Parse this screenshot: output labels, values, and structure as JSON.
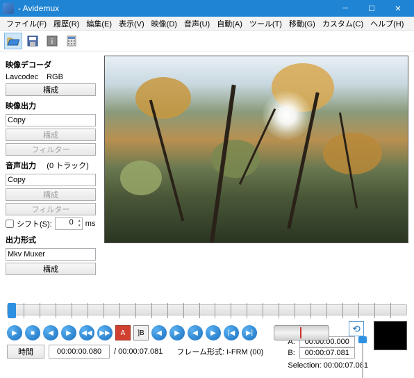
{
  "title": "- Avidemux",
  "menu": [
    "ファイル(F)",
    "履歴(R)",
    "編集(E)",
    "表示(V)",
    "映像(D)",
    "音声(U)",
    "自動(A)",
    "ツール(T)",
    "移動(G)",
    "カスタム(C)",
    "ヘルプ(H)"
  ],
  "sidebar": {
    "decoder_hdr": "映像デコーダ",
    "decoder_codec": "Lavcodec",
    "decoder_fmt": "RGB",
    "configure": "構成",
    "video_out_hdr": "映像出力",
    "video_out_value": "Copy",
    "filter": "フィルター",
    "audio_out_hdr": "音声出力",
    "audio_tracks": "(0 トラック)",
    "audio_out_value": "Copy",
    "shift_label": "シフト(S):",
    "shift_value": "0",
    "shift_unit": "ms",
    "format_hdr": "出力形式",
    "format_value": "Mkv Muxer"
  },
  "bottom": {
    "time_btn": "時間",
    "time_current": "00:00:00.080",
    "time_total": "/ 00:00:07.081",
    "frame_label": "フレーム形式: I-FRM (00)",
    "a_label": "A:",
    "a_value": "00:00:00.000",
    "b_label": "B:",
    "b_value": "00:00:07.081",
    "sel_label": "Selection: 00:00:07.081"
  }
}
